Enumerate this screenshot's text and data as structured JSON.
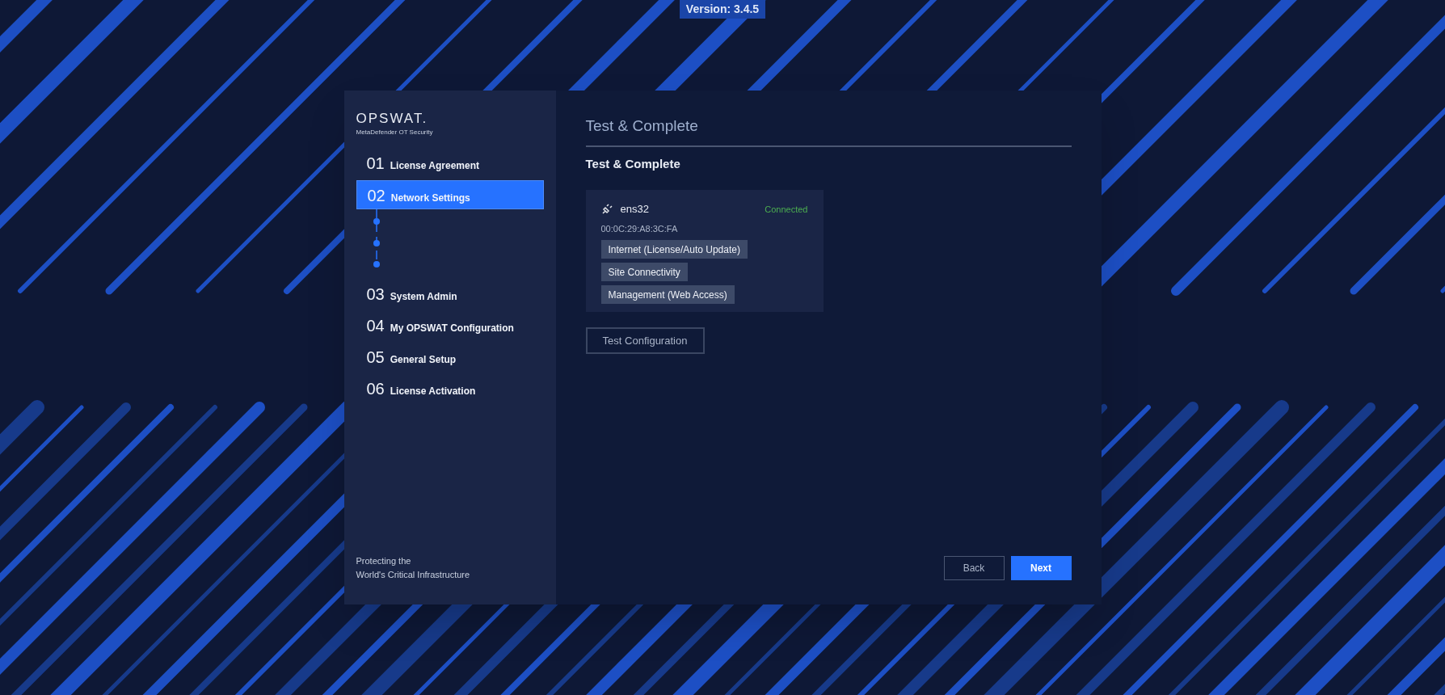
{
  "version": "Version: 3.4.5",
  "brand": {
    "logo": "OPSWAT.",
    "product": "MetaDefender OT Security"
  },
  "steps": [
    {
      "number": "01",
      "label": "License Agreement",
      "selected": false
    },
    {
      "number": "02",
      "label": "Network Settings",
      "selected": true
    },
    {
      "number": "03",
      "label": "System Admin",
      "selected": false
    },
    {
      "number": "04",
      "label": "My OPSWAT Configuration",
      "selected": false
    },
    {
      "number": "05",
      "label": "General Setup",
      "selected": false
    },
    {
      "number": "06",
      "label": "License Activation",
      "selected": false
    }
  ],
  "tagline": [
    "Protecting the",
    "World's Critical Infrastructure"
  ],
  "page_title": "Test & Complete",
  "section_title": "Test & Complete",
  "interface": {
    "name": "ens32",
    "status": "Connected",
    "connected": true,
    "mac": "00:0C:29:A8:3C:FA",
    "roles": [
      "Internet (License/Auto Update)",
      "Site Connectivity",
      "Management (Web Access)"
    ]
  },
  "test_button": "Test Configuration",
  "buttons": [
    {
      "label": "Back",
      "kind": "secondary"
    },
    {
      "label": "Next",
      "kind": "primary"
    }
  ]
}
